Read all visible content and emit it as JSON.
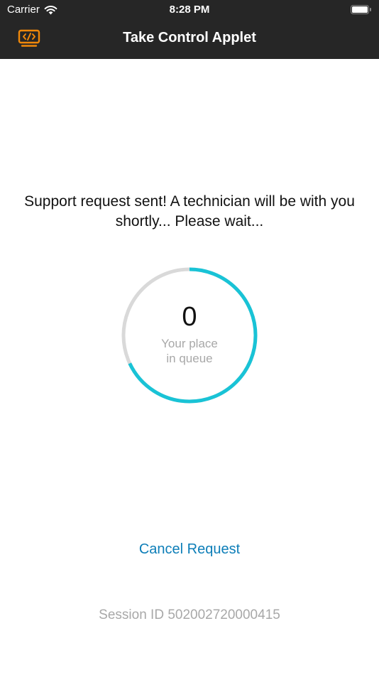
{
  "status_bar": {
    "carrier": "Carrier",
    "time": "8:28 PM"
  },
  "nav": {
    "title": "Take Control Applet",
    "logo_icon": "remote-code-screen-icon",
    "accent_color": "#f0880a"
  },
  "message": "Support request sent! A technician will be with you shortly... Please wait...",
  "queue": {
    "position": "0",
    "label_line1": "Your place",
    "label_line2": "in queue",
    "ring_color": "#19c3d6",
    "track_color": "#d9d9d9",
    "progress_fraction": 0.68
  },
  "actions": {
    "cancel_label": "Cancel Request"
  },
  "session": {
    "id_text": "Session ID 502002720000415"
  }
}
